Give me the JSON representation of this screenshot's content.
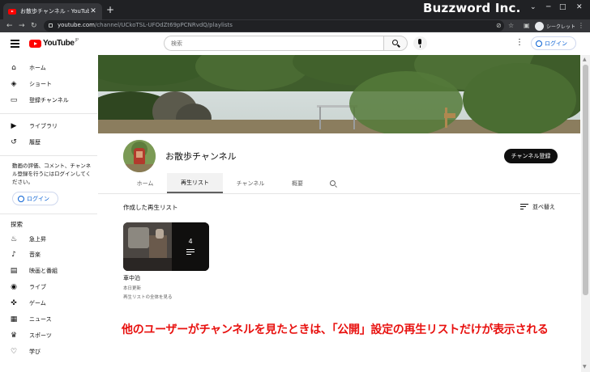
{
  "browser": {
    "tab_title": "お散歩チャンネル - YouTube",
    "tab_close": "✕",
    "new_tab": "+",
    "url_host": "youtube.com",
    "url_path": "/channel/UCkoTSL-UFOdZt69pPCNRvdQ/playlists",
    "incognito_label": "シークレット"
  },
  "watermark": "Buzzword Inc.",
  "yt": {
    "logo_text": "YouTube",
    "logo_region": "JP",
    "search_placeholder": "検索",
    "login_label": "ログイン"
  },
  "sidebar": {
    "main": [
      {
        "label": "ホーム",
        "icon": "home-icon"
      },
      {
        "label": "ショート",
        "icon": "shorts-icon"
      },
      {
        "label": "登録チャンネル",
        "icon": "subscriptions-icon"
      }
    ],
    "library": [
      {
        "label": "ライブラリ",
        "icon": "library-icon"
      },
      {
        "label": "履歴",
        "icon": "history-icon"
      }
    ],
    "note": "動画の評価、コメント、チャンネル登録を行うにはログインしてください。",
    "login_label": "ログイン",
    "explore_heading": "探索",
    "explore": [
      {
        "label": "急上昇",
        "icon": "trending-icon"
      },
      {
        "label": "音楽",
        "icon": "music-icon"
      },
      {
        "label": "映画と番組",
        "icon": "movies-icon"
      },
      {
        "label": "ライブ",
        "icon": "live-icon"
      },
      {
        "label": "ゲーム",
        "icon": "gaming-icon"
      },
      {
        "label": "ニュース",
        "icon": "news-icon"
      },
      {
        "label": "スポーツ",
        "icon": "sports-icon"
      },
      {
        "label": "学び",
        "icon": "learning-icon"
      }
    ]
  },
  "channel": {
    "name": "お散歩チャンネル",
    "subscribe_label": "チャンネル登録",
    "tabs": [
      "ホーム",
      "再生リスト",
      "チャンネル",
      "概要"
    ],
    "active_tab": "再生リスト"
  },
  "playlists": {
    "section_title": "作成した再生リスト",
    "sort_label": "並べ替え",
    "items": [
      {
        "title": "車中泊",
        "video_count": "4",
        "updated": "本日更新",
        "view_all": "再生リストの全体を見る"
      }
    ]
  },
  "caption": "他のユーザーがチャンネルを見たときは、「公開」設定の再生リストだけが表示される",
  "colors": {
    "caption": "#e8110f",
    "accent_blue": "#065fd4",
    "youtube_red": "#ff0000"
  }
}
